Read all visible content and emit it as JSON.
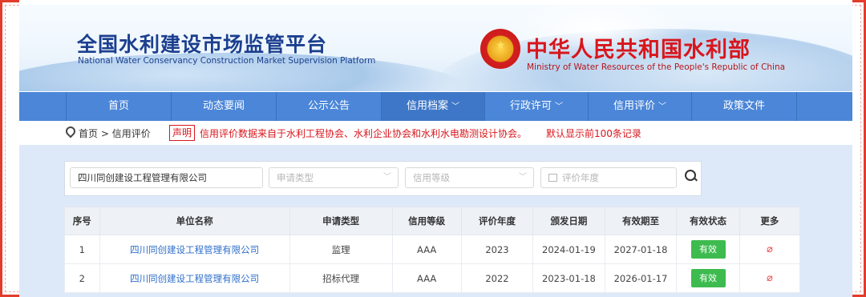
{
  "header": {
    "platform_title": "全国水利建设市场监管平台",
    "platform_title_en": "National Water Conservancy Construction Market Supervision Platform",
    "ministry_title": "中华人民共和国水利部",
    "ministry_title_en": "Ministry of Water Resources of the People's Republic of China"
  },
  "nav": {
    "items": [
      {
        "label": "首页",
        "dropdown": false
      },
      {
        "label": "动态要闻",
        "dropdown": false
      },
      {
        "label": "公示公告",
        "dropdown": false
      },
      {
        "label": "信用档案",
        "dropdown": true
      },
      {
        "label": "行政许可",
        "dropdown": true
      },
      {
        "label": "信用评价",
        "dropdown": true
      },
      {
        "label": "政策文件",
        "dropdown": false
      }
    ]
  },
  "breadcrumb": {
    "home": "首页",
    "separator": ">",
    "current": "信用评价"
  },
  "notice": {
    "badge": "声明",
    "text": "信用评价数据来自于水利工程协会、水利企业协会和水利水电勘测设计协会。",
    "extra": "默认显示前100条记录"
  },
  "filters": {
    "company_value": "四川同创建设工程管理有限公司",
    "apply_type_placeholder": "申请类型",
    "credit_level_placeholder": "信用等级",
    "eval_year_placeholder": "评价年度"
  },
  "table": {
    "columns": [
      "序号",
      "单位名称",
      "申请类型",
      "信用等级",
      "评价年度",
      "颁发日期",
      "有效期至",
      "有效状态",
      "更多"
    ],
    "rows": [
      {
        "no": "1",
        "name": "四川同创建设工程管理有限公司",
        "type": "监理",
        "level": "AAA",
        "year": "2023",
        "issued": "2024-01-19",
        "expires": "2027-01-18",
        "status": "有效"
      },
      {
        "no": "2",
        "name": "四川同创建设工程管理有限公司",
        "type": "招标代理",
        "level": "AAA",
        "year": "2022",
        "issued": "2023-01-18",
        "expires": "2026-01-17",
        "status": "有效"
      }
    ]
  },
  "icons": {
    "emblem": "national-emblem-icon",
    "search": "search-icon",
    "calendar": "calendar-icon",
    "more": "paperclip-icon",
    "location": "location-pin-icon"
  },
  "colors": {
    "nav": "#4b86d8",
    "brand_blue": "#1b3f8f",
    "brand_red": "#d8161c",
    "status_green": "#3dbb4e"
  }
}
